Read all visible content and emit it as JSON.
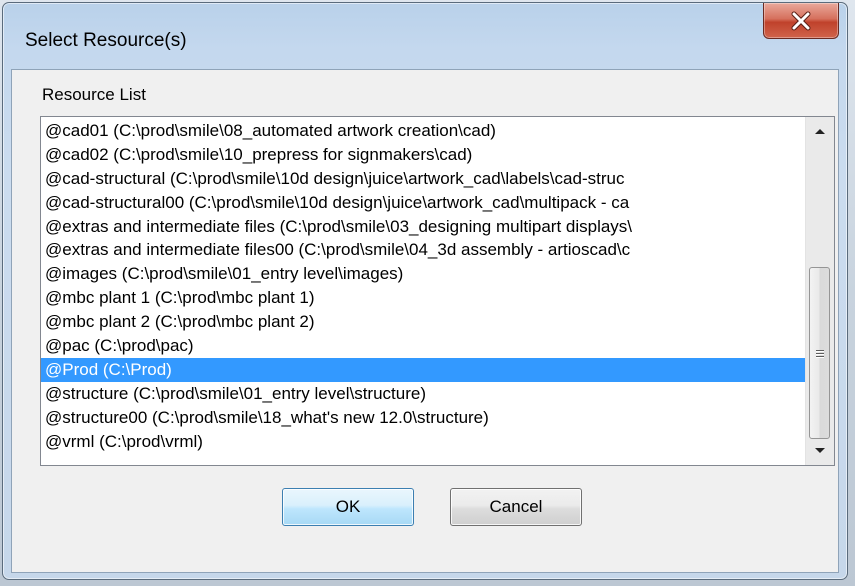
{
  "window": {
    "title": "Select Resource(s)"
  },
  "group": {
    "label": "Resource List"
  },
  "resources": [
    "@cad01  (C:\\prod\\smile\\08_automated artwork creation\\cad)",
    "@cad02  (C:\\prod\\smile\\10_prepress for signmakers\\cad)",
    "@cad-structural  (C:\\prod\\smile\\10d design\\juice\\artwork_cad\\labels\\cad-struc",
    "@cad-structural00  (C:\\prod\\smile\\10d design\\juice\\artwork_cad\\multipack - ca",
    "@extras and intermediate files  (C:\\prod\\smile\\03_designing multipart displays\\",
    "@extras and intermediate files00  (C:\\prod\\smile\\04_3d assembly - artioscad\\c",
    "@images  (C:\\prod\\smile\\01_entry level\\images)",
    "@mbc plant 1  (C:\\prod\\mbc plant 1)",
    "@mbc plant 2  (C:\\prod\\mbc plant 2)",
    "@pac  (C:\\prod\\pac)",
    "@Prod  (C:\\Prod)",
    "@structure  (C:\\prod\\smile\\01_entry level\\structure)",
    "@structure00  (C:\\prod\\smile\\18_what's new 12.0\\structure)",
    "@vrml  (C:\\prod\\vrml)"
  ],
  "selected_resource": "@Prod  (C:\\Prod)",
  "buttons": {
    "ok_label": "OK",
    "cancel_label": "Cancel"
  },
  "icons": {
    "close": "close-icon",
    "scroll_up": "scroll-up-arrow-icon",
    "scroll_down": "scroll-down-arrow-icon",
    "scroll_grip": "scroll-grip-icon"
  },
  "colors": {
    "selection": "#3399ff",
    "close_button": "#c7503b",
    "default_button_border": "#3c7fb1"
  }
}
